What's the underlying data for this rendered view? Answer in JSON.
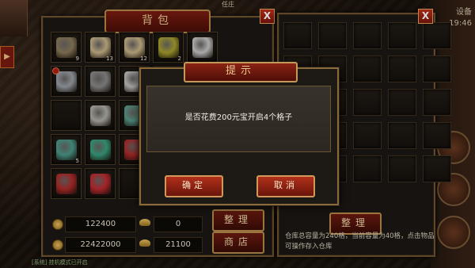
{
  "hud": {
    "top_title": "任庄",
    "time": "19:46",
    "side_text": "设备"
  },
  "bag": {
    "title": "背包",
    "close": "X",
    "items": [
      {
        "name": "scroll-item",
        "qty": "9",
        "color": "#8a7a5a"
      },
      {
        "name": "parchment-item",
        "qty": "13",
        "color": "#c9b58a"
      },
      {
        "name": "parchment-item",
        "qty": "12",
        "color": "#c9b58a"
      },
      {
        "name": "herb-item",
        "qty": "2",
        "color": "#a8a030"
      },
      {
        "name": "ring-item",
        "qty": "",
        "color": "#c8c8c8"
      },
      {
        "name": "ring-item",
        "qty": "",
        "color": "#9aa0a8",
        "mark": true
      },
      {
        "name": "boots-item",
        "qty": "",
        "color": "#8a8a8a"
      },
      {
        "name": "necklace-item",
        "qty": "",
        "color": "#c0c0c0"
      },
      {
        "name": "bracelet-item",
        "qty": "",
        "color": "#a8a8a8"
      },
      {
        "name": "",
        "qty": "",
        "color": ""
      },
      {
        "name": "",
        "qty": "",
        "color": ""
      },
      {
        "name": "necklace-item",
        "qty": "",
        "color": "#b0b0a8"
      },
      {
        "name": "bracelet-item",
        "qty": "",
        "color": "#5a9a8a"
      },
      {
        "name": "",
        "qty": "",
        "color": ""
      },
      {
        "name": "",
        "qty": "",
        "color": ""
      },
      {
        "name": "potion-item",
        "qty": "5",
        "color": "#4a9a8a"
      },
      {
        "name": "potion-item",
        "qty": "",
        "color": "#3aa080"
      },
      {
        "name": "potion-item",
        "qty": "",
        "color": "#b02a2a"
      },
      {
        "name": "",
        "qty": "",
        "color": ""
      },
      {
        "name": "",
        "qty": "",
        "color": ""
      },
      {
        "name": "potion-item",
        "qty": "",
        "color": "#b02a2a"
      },
      {
        "name": "potion-item",
        "qty": "",
        "color": "#c02a30"
      },
      {
        "name": "",
        "qty": "",
        "color": ""
      },
      {
        "name": "",
        "qty": "",
        "color": ""
      },
      {
        "name": "",
        "qty": "",
        "color": ""
      }
    ],
    "gold": "122400",
    "ingot": "0",
    "gold_bound": "22422000",
    "ingot_bound": "21100",
    "sort_label": "整理",
    "shop_label": "商店"
  },
  "warehouse": {
    "close": "X",
    "sort_label": "整理",
    "note": "仓库总容量为240格，当前容量为40格，点击物品可操作存入仓库"
  },
  "dialog": {
    "title": "提示",
    "message": "是否花费200元宝开启4个格子",
    "confirm": "确定",
    "cancel": "取消"
  },
  "footer": {
    "status": "[系统] 挂机模式已开启"
  }
}
